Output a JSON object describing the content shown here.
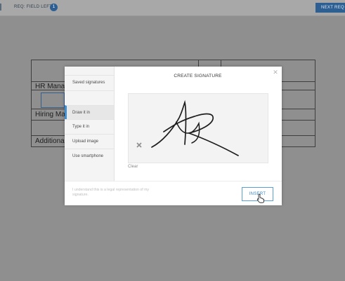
{
  "topbar": {
    "req_label": "REQ: FIELD LEFT",
    "req_count": "1",
    "next_label": "NEXT REQ"
  },
  "document": {
    "rows": [
      "HR Manag",
      "Hiring Ma",
      "Additional"
    ]
  },
  "modal": {
    "title": "CREATE SIGNATURE",
    "sidebar": [
      {
        "label": "Saved signatures",
        "active": false
      },
      {
        "label": "Draw it in",
        "active": true
      },
      {
        "label": "Type it in",
        "active": false
      },
      {
        "label": "Upload image",
        "active": false
      },
      {
        "label": "Use smartphone",
        "active": false
      }
    ],
    "clear_label": "Clear",
    "disclaimer": "I understand this is a legal representation of my signature.",
    "insert_label": "INSERT"
  },
  "colors": {
    "accent": "#3f8ed2",
    "badge": "#2d5f93",
    "overlay": "#8f8f8f"
  }
}
